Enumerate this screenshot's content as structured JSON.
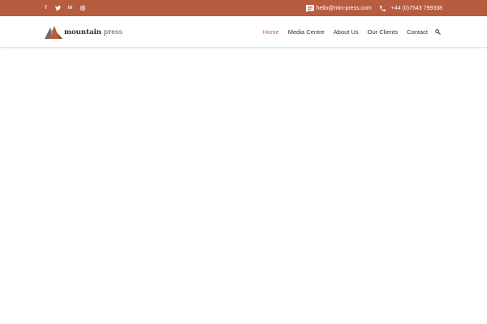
{
  "colors": {
    "topbar": "#b85c3f",
    "accent": "#c0664a",
    "text": "#333333",
    "background": "#ffffff"
  },
  "social": [
    {
      "name": "facebook",
      "icon": "facebook-icon",
      "glyph": "f"
    },
    {
      "name": "twitter",
      "icon": "twitter-icon",
      "glyph": ""
    },
    {
      "name": "linkedin",
      "icon": "linkedin-icon",
      "glyph": "in"
    },
    {
      "name": "instagram",
      "icon": "instagram-icon",
      "glyph": ""
    }
  ],
  "contact": {
    "email": "hello@mtn-press.com",
    "phone": "+44 (0)7543 799338",
    "email_icon": "chat-icon",
    "phone_icon": "phone-icon"
  },
  "logo": {
    "bold": "mountain",
    "light": " press"
  },
  "nav": {
    "items": [
      "Home",
      "Media Centre",
      "About Us",
      "Our Clients",
      "Contact"
    ],
    "active": "Home",
    "search_icon": "search-icon"
  }
}
